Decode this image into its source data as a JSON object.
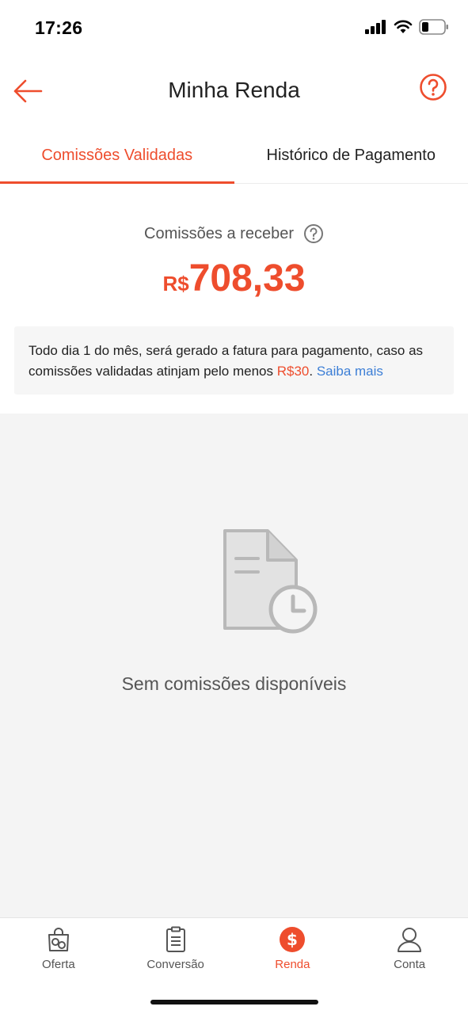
{
  "status_bar": {
    "time": "17:26",
    "icons": [
      "signal-icon",
      "wifi-icon",
      "battery-icon"
    ]
  },
  "header": {
    "title": "Minha Renda",
    "back_icon": "arrow-left-icon",
    "help_icon": "question-circle-icon"
  },
  "tabs": [
    {
      "label": "Comissões Validadas",
      "active": true
    },
    {
      "label": "Histórico de Pagamento",
      "active": false
    }
  ],
  "summary": {
    "label": "Comissões a receber",
    "currency": "R$",
    "amount": "708,33"
  },
  "notice": {
    "text_before": "Todo dia 1 do mês, será gerado a fatura para pagamento, caso as comissões validadas atinjam pelo menos ",
    "minimum": "R$30",
    "separator": ". ",
    "link": "Saiba mais"
  },
  "empty_state": {
    "icon": "document-clock-icon",
    "text": "Sem comissões disponíveis"
  },
  "bottom_nav": [
    {
      "label": "Oferta",
      "icon": "shopping-bag-icon",
      "active": false
    },
    {
      "label": "Conversão",
      "icon": "clipboard-icon",
      "active": false
    },
    {
      "label": "Renda",
      "icon": "dollar-circle-icon",
      "active": true
    },
    {
      "label": "Conta",
      "icon": "user-icon",
      "active": false
    }
  ],
  "colors": {
    "accent": "#ee4d2d",
    "link": "#3d7fd6",
    "background": "#f4f4f4"
  }
}
